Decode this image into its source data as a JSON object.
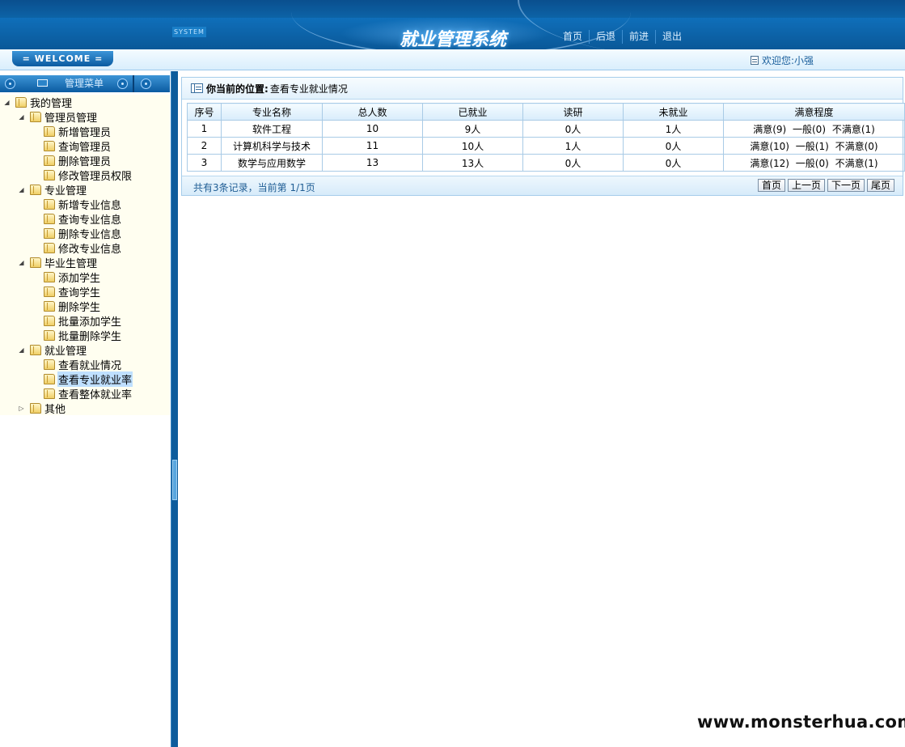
{
  "header": {
    "system_tag": "SYSTEM",
    "title": "就业管理系统",
    "nav": [
      "首页",
      "后退",
      "前进",
      "退出"
    ]
  },
  "strip": {
    "welcome": "= WELCOME =",
    "user_text": "欢迎您:小强"
  },
  "sidebar": {
    "menu_title": "管理菜单",
    "tree": [
      {
        "label": "我的管理",
        "level": 0
      },
      {
        "label": "管理员管理",
        "level": 1
      },
      {
        "label": "新增管理员",
        "level": 2
      },
      {
        "label": "查询管理员",
        "level": 2
      },
      {
        "label": "删除管理员",
        "level": 2
      },
      {
        "label": "修改管理员权限",
        "level": 2
      },
      {
        "label": "专业管理",
        "level": 1
      },
      {
        "label": "新增专业信息",
        "level": 2
      },
      {
        "label": "查询专业信息",
        "level": 2
      },
      {
        "label": "删除专业信息",
        "level": 2
      },
      {
        "label": "修改专业信息",
        "level": 2
      },
      {
        "label": "毕业生管理",
        "level": 1
      },
      {
        "label": "添加学生",
        "level": 2
      },
      {
        "label": "查询学生",
        "level": 2
      },
      {
        "label": "删除学生",
        "level": 2
      },
      {
        "label": "批量添加学生",
        "level": 2
      },
      {
        "label": "批量删除学生",
        "level": 2
      },
      {
        "label": "就业管理",
        "level": 1
      },
      {
        "label": "查看就业情况",
        "level": 2
      },
      {
        "label": "查看专业就业率",
        "level": 2,
        "selected": true
      },
      {
        "label": "查看整体就业率",
        "level": 2
      },
      {
        "label": "其他",
        "level": 1,
        "collapsed": true
      }
    ]
  },
  "main": {
    "crumb_label": "你当前的位置:",
    "crumb_value": "查看专业就业情况",
    "columns": [
      "序号",
      "专业名称",
      "总人数",
      "已就业",
      "读研",
      "未就业",
      "满意程度"
    ],
    "rows": [
      [
        "1",
        "软件工程",
        "10",
        "9人",
        "0人",
        "1人",
        "满意(9) 一般(0) 不满意(1)"
      ],
      [
        "2",
        "计算机科学与技术",
        "11",
        "10人",
        "1人",
        "0人",
        "满意(10) 一般(1) 不满意(0)"
      ],
      [
        "3",
        "数学与应用数学",
        "13",
        "13人",
        "0人",
        "0人",
        "满意(12) 一般(0) 不满意(1)"
      ]
    ],
    "record_info": "共有3条记录，当前第 1/1页",
    "pager": [
      "首页",
      "上一页",
      "下一页",
      "尾页"
    ]
  },
  "watermark": "www.monsterhua.com"
}
